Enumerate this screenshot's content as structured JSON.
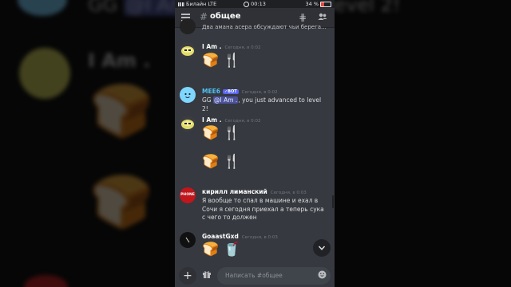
{
  "status_bar": {
    "carrier": "Билайн",
    "network": "LTE",
    "time": "00:13",
    "battery": "34 %"
  },
  "header": {
    "channel": "общее"
  },
  "messages": {
    "cut_top_text": "Два амана асера обсуждают чьи берега...",
    "m1": {
      "author": "I Am .",
      "time": "Сегодня, в 0:02",
      "emoji": "🍞 🍴"
    },
    "m2": {
      "author": "MEE6",
      "badge": "✓BOT",
      "time": "Сегодня, в 0:02",
      "text_prefix": "GG ",
      "mention": "@I Am .",
      "text_suffix": ", you just advanced to level 2!"
    },
    "m3": {
      "author": "I Am .",
      "time": "Сегодня, в 0:02",
      "emoji1": "🍞 🍴",
      "emoji2": "🍞 🍴"
    },
    "m4": {
      "author": "кирилл лиманский",
      "time": "Сегодня, в 0:03",
      "text": "Я вообще то спал в машине и ехал в Сочи я сегодня приехал а теперь сука с чего то должен",
      "avatar_text": "PHONE"
    },
    "m5": {
      "author": "GoaastGxd",
      "time": "Сегодня, в 0:03",
      "emoji": "🍞 🥤"
    }
  },
  "composer": {
    "placeholder": "Написать #общее"
  },
  "background": {
    "line1_prefix": "GG ",
    "line1_mention": "@I Am",
    "line1_suffix": "ced to level 2!",
    "author": "I Am ."
  },
  "icons": [
    "hamburger-icon",
    "hash-icon",
    "threads-icon",
    "members-icon",
    "plus-icon",
    "gift-icon",
    "emoji-icon",
    "chevron-down-icon"
  ],
  "colors": {
    "bg": "#36393f",
    "header": "#2f3136",
    "mention": "#4b5299",
    "bot": "#5865f2",
    "input": "#40444b"
  }
}
